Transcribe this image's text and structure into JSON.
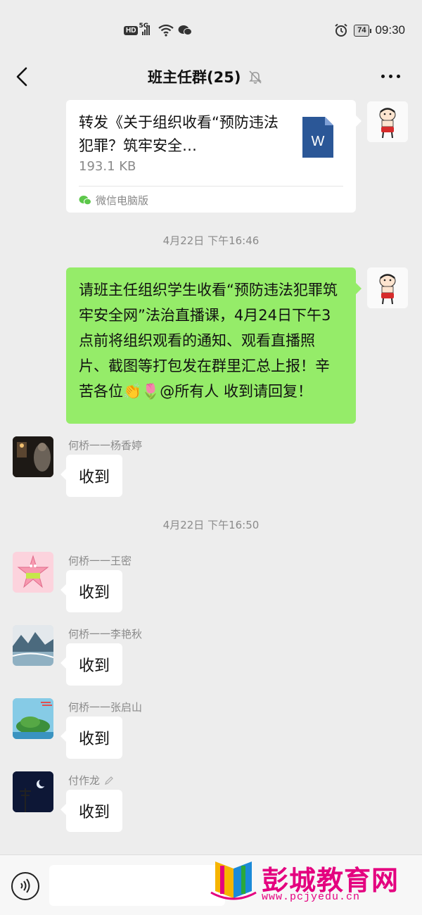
{
  "status_bar": {
    "hd": "HD",
    "net": "5G",
    "battery": "74",
    "time": "09:30"
  },
  "nav": {
    "title": "班主任群(25)"
  },
  "file_message": {
    "title": "转发《关于组织收看“预防违法犯罪？筑牢安全…",
    "size": "193.1 KB",
    "source": "微信电脑版",
    "doc_letter": "W"
  },
  "timestamps": [
    "4月22日 下午16:46",
    "4月22日 下午16:50"
  ],
  "own_message": {
    "text": "请班主任组织学生收看“预防违法犯罪筑牢安全网”法治直播课，4月24日下午3点前将组织观看的通知、观看直播照片、截图等打包发在群里汇总上报！辛苦各位👏🌷@所有人  收到请回复！"
  },
  "messages": [
    {
      "sender": "何桥一一杨香婷",
      "text": "收到",
      "avatar": "dark-photo-avatar"
    },
    {
      "sender": "何桥一一王密",
      "text": "收到",
      "avatar": "patrick-star-avatar"
    },
    {
      "sender": "何桥一一李艳秋",
      "text": "收到",
      "avatar": "landscape-painting-avatar"
    },
    {
      "sender": "何桥一一张启山",
      "text": "收到",
      "avatar": "island-avatar"
    },
    {
      "sender": "付作龙",
      "text": "收到",
      "avatar": "night-moon-avatar"
    }
  ],
  "watermark": {
    "brand": "彭城教育网",
    "url": "www.pcjyedu.cn"
  },
  "colors": {
    "background": "#ededed",
    "own_bubble": "#95ec69",
    "other_bubble": "#ffffff",
    "watermark": "#e4007f",
    "doc_icon": "#2b5797"
  }
}
